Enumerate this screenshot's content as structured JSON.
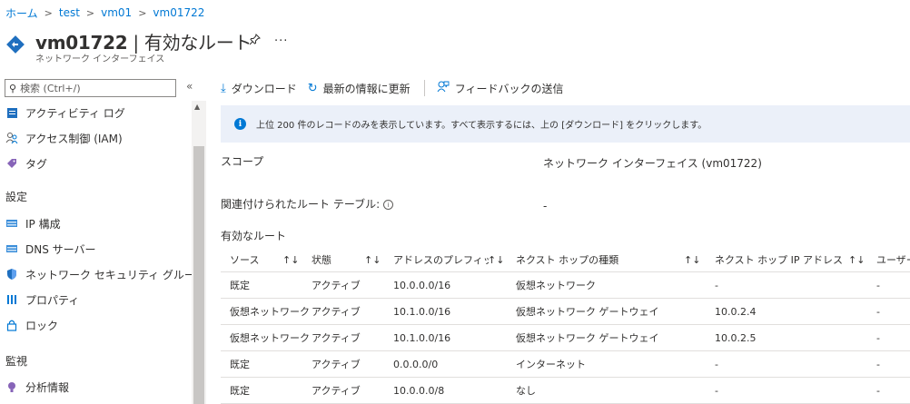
{
  "breadcrumb": [
    "ホーム",
    "test",
    "vm01",
    "vm01722"
  ],
  "header": {
    "title_name": "vm01722",
    "title_rest": " | 有効なルート",
    "subtitle": "ネットワーク インターフェイス",
    "more": "..."
  },
  "sidebar": {
    "search_placeholder": "検索 (Ctrl+/)",
    "collapse": "«",
    "items_top": [
      {
        "label": "アクティビティ ログ",
        "icon": "activity-log-icon"
      },
      {
        "label": "アクセス制御 (IAM)",
        "icon": "iam-icon"
      },
      {
        "label": "タグ",
        "icon": "tag-icon"
      }
    ],
    "section_settings": "設定",
    "items_settings": [
      {
        "label": "IP 構成",
        "icon": "ip-config-icon"
      },
      {
        "label": "DNS サーバー",
        "icon": "dns-icon"
      },
      {
        "label": "ネットワーク セキュリティ グループ",
        "icon": "nsg-shield-icon"
      },
      {
        "label": "プロパティ",
        "icon": "properties-icon"
      },
      {
        "label": "ロック",
        "icon": "lock-icon"
      }
    ],
    "section_monitoring": "監視",
    "items_monitoring": [
      {
        "label": "分析情報",
        "icon": "insights-icon"
      }
    ]
  },
  "toolbar": {
    "download": "ダウンロード",
    "refresh": "最新の情報に更新",
    "feedback": "フィードバックの送信"
  },
  "banner": {
    "text": "上位 200 件のレコードのみを表示しています。すべて表示するには、上の [ダウンロード] をクリックします。"
  },
  "properties": {
    "scope_label": "スコープ",
    "scope_value": "ネットワーク インターフェイス (vm01722)",
    "route_table_label": "関連付けられたルート テーブル:",
    "route_table_value": "-",
    "effective_routes_label": "有効なルート"
  },
  "table": {
    "columns": [
      "ソース",
      "状態",
      "アドレスのプレフィック...",
      "ネクスト ホップの種類",
      "ネクスト ホップ IP アドレス",
      "ユーザー定"
    ],
    "rows": [
      [
        "既定",
        "アクティブ",
        "10.0.0.0/16",
        "仮想ネットワーク",
        "-",
        "-"
      ],
      [
        "仮想ネットワーク...",
        "アクティブ",
        "10.1.0.0/16",
        "仮想ネットワーク ゲートウェイ",
        "10.0.2.4",
        "-"
      ],
      [
        "仮想ネットワーク...",
        "アクティブ",
        "10.1.0.0/16",
        "仮想ネットワーク ゲートウェイ",
        "10.0.2.5",
        "-"
      ],
      [
        "既定",
        "アクティブ",
        "0.0.0.0/0",
        "インターネット",
        "-",
        "-"
      ],
      [
        "既定",
        "アクティブ",
        "10.0.0.0/8",
        "なし",
        "-",
        "-"
      ]
    ]
  },
  "colors": {
    "accent": "#0078d4",
    "banner_bg": "#ebf0f9"
  }
}
